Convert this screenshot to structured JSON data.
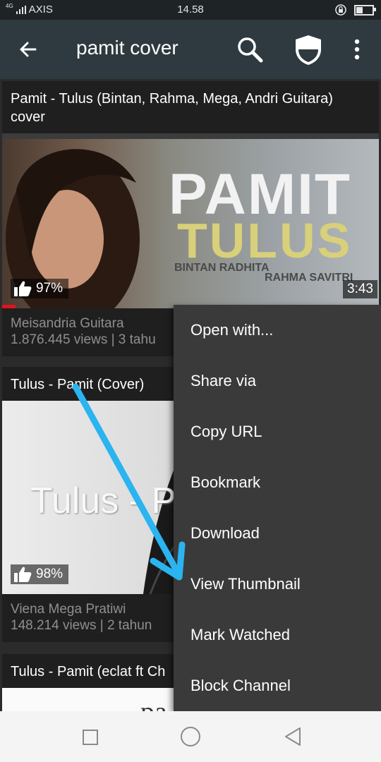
{
  "status": {
    "network": "4G",
    "carrier": "AXIS",
    "time": "14.58",
    "battery_level": 0.4
  },
  "appbar": {
    "title": "pamit cover",
    "back_icon": "back-arrow-icon",
    "search_icon": "search-icon",
    "shield_icon": "shield-icon",
    "more_icon": "more-vert-icon"
  },
  "videos": [
    {
      "title": "Pamit - Tulus (Bintan, Rahma, Mega, Andri Guitara) cover",
      "thumb_big": "PAMIT",
      "thumb_sub": "TULUS",
      "thumb_name1": "BINTAN RADHITA",
      "thumb_name2": "RAHMA SAVITRI",
      "likes": "97%",
      "duration": "3:43",
      "watched_fraction": 0.035,
      "channel": "Meisandria Guitara",
      "views": "1.876.445 views  |  3 tahu"
    },
    {
      "title": "Tulus - Pamit (Cover)",
      "thumb_text": "Tulus - Pa",
      "likes": "98%",
      "channel": "Viena Mega Pratiwi",
      "views": "148.214 views  |  2 tahun"
    },
    {
      "title": "Tulus - Pamit (eclat ft Ch",
      "thumb_text": "pa"
    }
  ],
  "menu": {
    "items": [
      "Open with...",
      "Share via",
      "Copy URL",
      "Bookmark",
      "Download",
      "View Thumbnail",
      "Mark Watched",
      "Block Channel"
    ]
  },
  "colors": {
    "appbar": "#2f3a40",
    "menu_bg": "#3a3a3a",
    "annotation_arrow": "#2ab4f0",
    "progress": "#e0141e"
  },
  "navbar": {
    "recent_icon": "square-recent-icon",
    "home_icon": "circle-home-icon",
    "back_icon": "triangle-back-icon"
  }
}
